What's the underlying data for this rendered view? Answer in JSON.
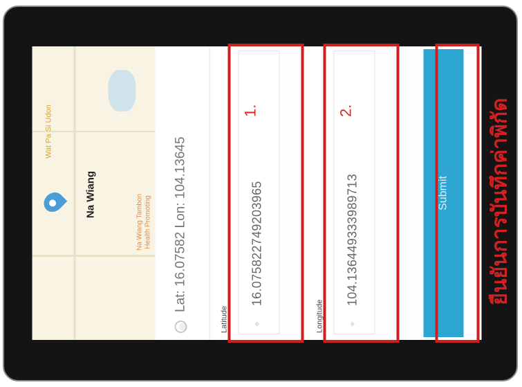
{
  "map": {
    "place_name": "Na Wiang",
    "poi_temple": "Wat Pa Si Udon",
    "poi_health": "Na Wiang Tambon Health Promoting"
  },
  "location": {
    "coords_text": "Lat: 16.07582  Lon: 104.13645"
  },
  "form": {
    "latitude_label": "Latitude",
    "latitude_value": "16.075822749203965",
    "longitude_label": "Longitude",
    "longitude_value": "104.136449333989713",
    "submit_label": "Submit"
  },
  "annotations": {
    "marker_1": "1.",
    "marker_2": "2.",
    "caption": "ยืนยันการบันทึกค่าพิกัด",
    "color": "#cc1f1f"
  },
  "icons": {
    "location": "location-target-icon",
    "map_pin": "map-pin-icon",
    "field_marker": "field-location-icon"
  }
}
